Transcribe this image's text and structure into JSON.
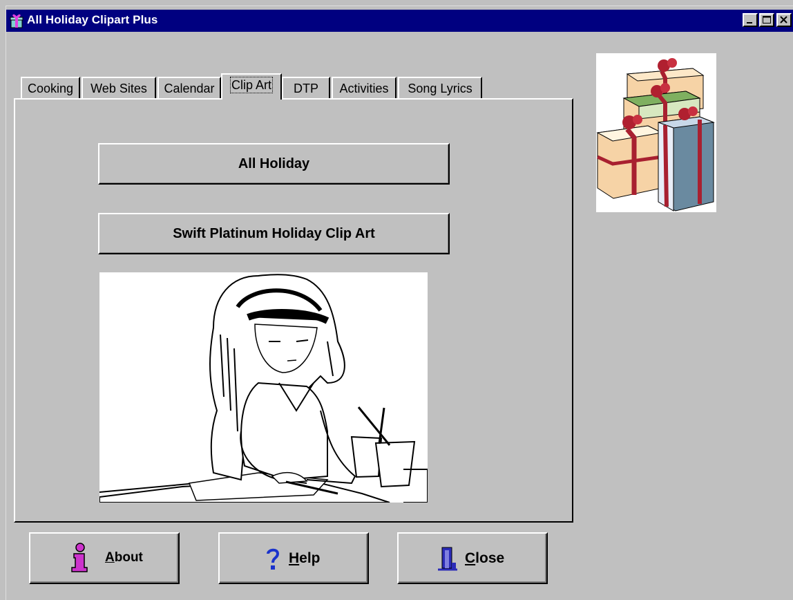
{
  "window": {
    "title": "All Holiday Clipart Plus",
    "icon": "gift-icon",
    "controls": [
      "minimize-icon",
      "maximize-icon",
      "close-icon"
    ]
  },
  "tabs": [
    {
      "label": "Cooking",
      "active": false
    },
    {
      "label": "Web Sites",
      "active": false
    },
    {
      "label": "Calendar",
      "active": false
    },
    {
      "label": "Clip Art",
      "active": true
    },
    {
      "label": "DTP",
      "active": false
    },
    {
      "label": "Activities",
      "active": false
    },
    {
      "label": "Song Lyrics",
      "active": false
    }
  ],
  "clip_art": {
    "all_holiday_label": "All Holiday",
    "swift_label": "Swift Platinum Holiday Clip Art",
    "illustration": "girl-drawing-illustration"
  },
  "decoration": {
    "image": "stacked-gift-boxes-illustration"
  },
  "footer": {
    "about": {
      "accel": "A",
      "rest": "bout",
      "icon": "info-icon"
    },
    "help": {
      "accel": "H",
      "rest": "elp",
      "icon": "question-icon"
    },
    "close": {
      "accel": "C",
      "rest": "lose",
      "icon": "exit-door-icon"
    }
  },
  "colors": {
    "face": "#c0c0c0",
    "titlebar": "#000080",
    "about_icon": "#cc33cc",
    "help_icon": "#1a33cc",
    "close_icon": "#2b2bb8"
  }
}
